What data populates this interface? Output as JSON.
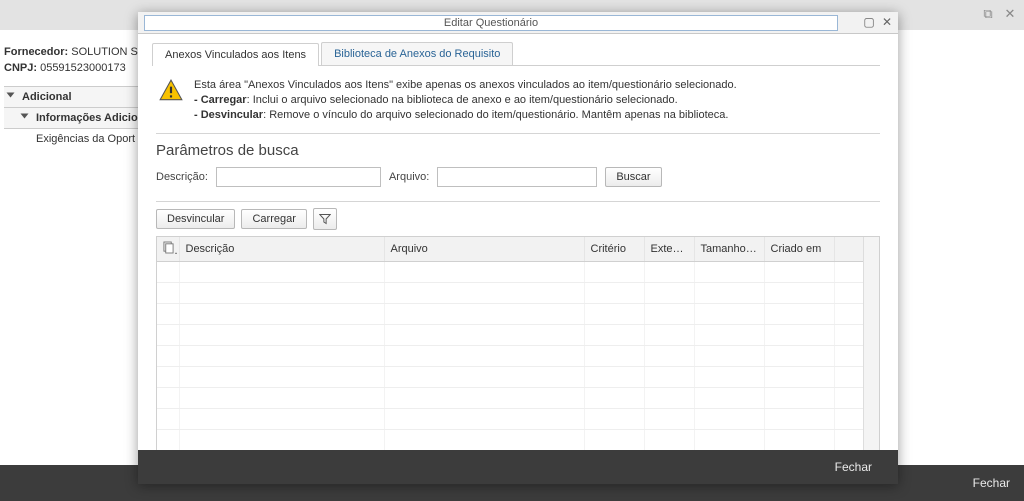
{
  "behind": {
    "fornecedor_label": "Fornecedor:",
    "fornecedor_value": "SOLUTION SY",
    "cnpj_label": "CNPJ:",
    "cnpj_value": "05591523000173",
    "tree": {
      "adicional": "Adicional",
      "info_adic": "Informações Adiciona",
      "exig": "Exigências da Oport"
    },
    "footer_close": "Fechar"
  },
  "modal": {
    "title": "Editar Questionário",
    "tabs": {
      "t1": "Anexos Vinculados aos Itens",
      "t2": "Biblioteca de Anexos do Requisito"
    },
    "info": {
      "line1": "Esta área \"Anexos Vinculados aos Itens\" exibe apenas os anexos vinculados ao item/questionário selecionado.",
      "carregar_b": "- Carregar",
      "carregar_t": ": Inclui o arquivo selecionado na biblioteca de anexo e ao item/questionário selecionado.",
      "desv_b": "- Desvincular",
      "desv_t": ": Remove o vínculo do arquivo selecionado do item/questionário. Mantêm apenas na biblioteca."
    },
    "search": {
      "title": "Parâmetros de busca",
      "desc_label": "Descrição:",
      "arq_label": "Arquivo:",
      "desc_value": "",
      "arq_value": "",
      "buscar": "Buscar"
    },
    "toolbar": {
      "desvincular": "Desvincular",
      "carregar": "Carregar"
    },
    "columns": {
      "descricao": "Descrição",
      "arquivo": "Arquivo",
      "criterio": "Critério",
      "extensao": "Exten…",
      "tamanho": "Tamanho …",
      "criado": "Criado em"
    },
    "footer_close": "Fechar"
  }
}
